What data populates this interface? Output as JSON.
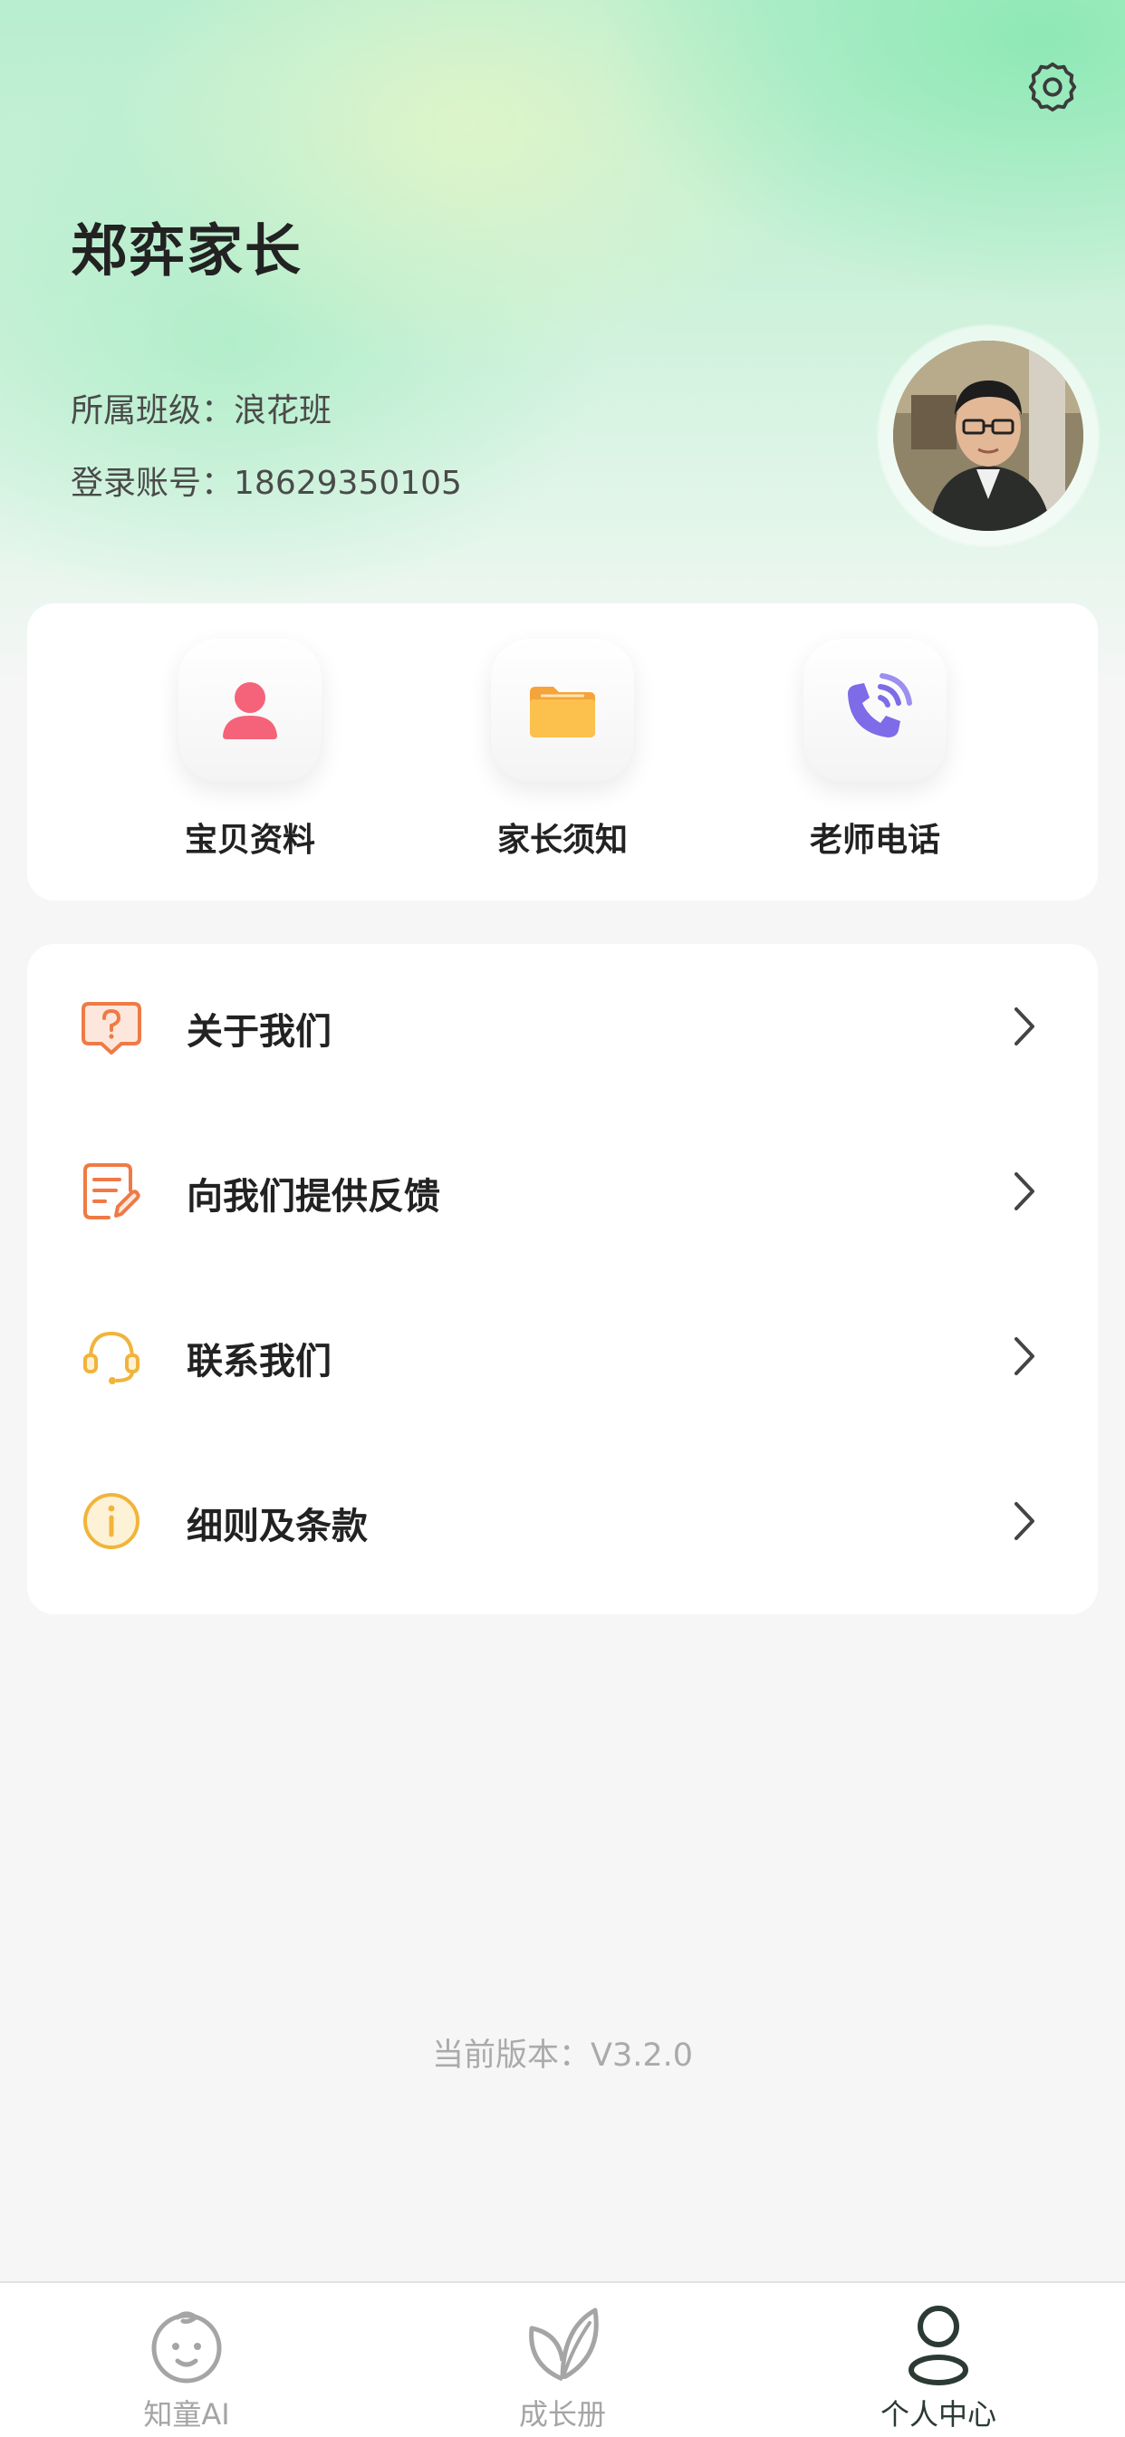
{
  "header": {
    "user_name": "郑弈家长",
    "class_label": "所属班级：",
    "class_value": "浪花班",
    "account_label": "登录账号：",
    "account_value": "18629350105",
    "settings_icon": "gear-icon",
    "avatar": "user-photo"
  },
  "quick_actions": [
    {
      "label": "宝贝资料",
      "icon": "person-icon",
      "color": "#f5637a"
    },
    {
      "label": "家长须知",
      "icon": "folder-icon",
      "color": "#f7a534"
    },
    {
      "label": "老师电话",
      "icon": "phone-icon",
      "color": "#7d6be8"
    }
  ],
  "menu": [
    {
      "label": "关于我们",
      "icon": "question-bubble-icon",
      "color": "#ef7a45"
    },
    {
      "label": "向我们提供反馈",
      "icon": "edit-document-icon",
      "color": "#ef7a45"
    },
    {
      "label": "联系我们",
      "icon": "headset-icon",
      "color": "#f1b43a"
    },
    {
      "label": "细则及条款",
      "icon": "info-icon",
      "color": "#f1b43a"
    }
  ],
  "version": "当前版本：V3.2.0",
  "tabs": [
    {
      "label": "知童AI",
      "icon": "baby-face-icon",
      "active": false
    },
    {
      "label": "成长册",
      "icon": "leaf-icon",
      "active": false
    },
    {
      "label": "个人中心",
      "icon": "person-outline-icon",
      "active": true
    }
  ],
  "colors": {
    "accent_green": "#a9ecc6",
    "active_tab": "#2b3a33",
    "inactive_tab": "#a5a5a5"
  }
}
